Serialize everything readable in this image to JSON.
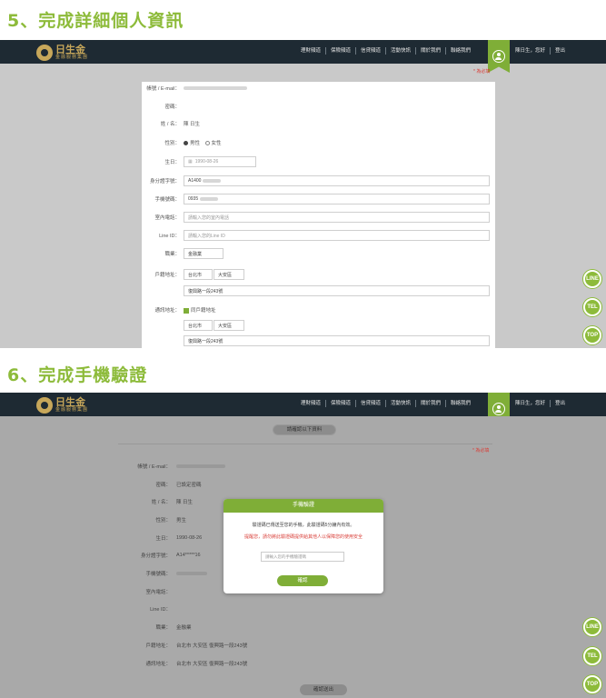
{
  "step5": {
    "title": "5、完成詳細個人資訊",
    "logo": {
      "name": "日生金",
      "sub": "金融服務集團"
    },
    "nav": [
      "理財頻道",
      "保險頻道",
      "信貸頻道",
      "活動快訊",
      "關於我們",
      "聯絡我們"
    ],
    "greeting": "陳日生，您好",
    "logout": "登出",
    "required_note": "* 為必填",
    "form": {
      "email_label": "帳號 / E-mail：",
      "password_label": "密碼：",
      "name_label": "姓 / 名：",
      "name_value": "陳 日生",
      "gender_label": "性別：",
      "gender_male": "男性",
      "gender_female": "女性",
      "birthday_label": "生日：",
      "birthday_value": "1990-08-26",
      "id_label": "身分證字號：",
      "id_value": "A1400",
      "mobile_label": "手機號碼：",
      "mobile_value": "0935",
      "phone_label": "室內電話：",
      "phone_placeholder": "請輸入您的室內電話",
      "line_label": "Line ID：",
      "line_placeholder": "請輸入您的Line ID",
      "job_label": "職業：",
      "job_value": "金融業",
      "home_label": "戶籍地址：",
      "home_city": "台北市",
      "home_district": "大安區",
      "home_street": "復興路一段243號",
      "mail_label": "通訊地址：",
      "same_as_home": "同戶籍地址",
      "mail_city": "台北市",
      "mail_district": "大安區",
      "mail_street": "復興路一段243號"
    },
    "side": [
      "LINE",
      "TEL",
      "TOP"
    ]
  },
  "step6": {
    "title": "6、完成手機驗證",
    "logo": {
      "name": "日生金",
      "sub": "金融服務集團"
    },
    "nav": [
      "理財頻道",
      "保險頻道",
      "信貸頻道",
      "活動快訊",
      "關於我們",
      "聯絡我們"
    ],
    "greeting": "陳日生，您好",
    "logout": "登出",
    "header_pill": "請確認以下資料",
    "required_note": "* 為必填",
    "rows": [
      {
        "label": "帳號 / E-mail：",
        "value": ""
      },
      {
        "label": "密碼：",
        "value": "已設定密碼"
      },
      {
        "label": "姓 / 名：",
        "value": "陳 日生"
      },
      {
        "label": "性別：",
        "value": "男生"
      },
      {
        "label": "生日：",
        "value": "1990-08-26"
      },
      {
        "label": "身分證字號：",
        "value": "A14*****16"
      },
      {
        "label": "手機號碼：",
        "value": ""
      },
      {
        "label": "室內電話：",
        "value": ""
      },
      {
        "label": "Line ID：",
        "value": ""
      },
      {
        "label": "職業：",
        "value": "金融業"
      },
      {
        "label": "戶籍地址：",
        "value": "台北市 大安區 復興路一段243號"
      },
      {
        "label": "通訊地址：",
        "value": "台北市 大安區 復興路一段243號"
      }
    ],
    "modal": {
      "title": "手機驗證",
      "message": "驗證碼已傳送至您的手機，此驗證碼5分鐘內有效。",
      "warning": "提醒您，請勿將此驗證碼提供給其他人以保障您的使用安全",
      "input_placeholder": "請輸入您的手機驗證碼",
      "confirm": "確認"
    },
    "bottom_pill": "確認送出",
    "side": [
      "LINE",
      "TEL",
      "TOP"
    ]
  }
}
